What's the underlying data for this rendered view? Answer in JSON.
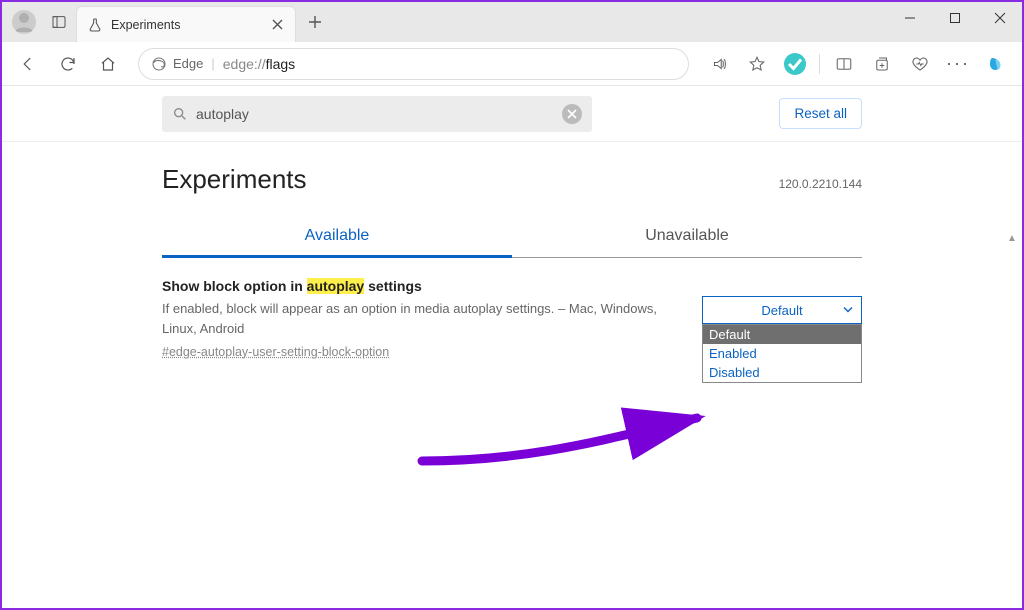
{
  "window": {
    "tab_title": "Experiments",
    "address_prefix": "edge://",
    "address_path": "flags",
    "address_identity": "Edge"
  },
  "search": {
    "value": "autoplay",
    "reset_label": "Reset all"
  },
  "header": {
    "title": "Experiments",
    "version": "120.0.2210.144"
  },
  "subtabs": {
    "available": "Available",
    "unavailable": "Unavailable"
  },
  "flag": {
    "title_prefix": "Show block option in ",
    "title_highlight": "autoplay",
    "title_suffix": " settings",
    "description": "If enabled, block will appear as an option in media autoplay settings. – Mac, Windows, Linux, Android",
    "hash": "#edge-autoplay-user-setting-block-option",
    "selected": "Default",
    "options": [
      "Default",
      "Enabled",
      "Disabled"
    ]
  }
}
